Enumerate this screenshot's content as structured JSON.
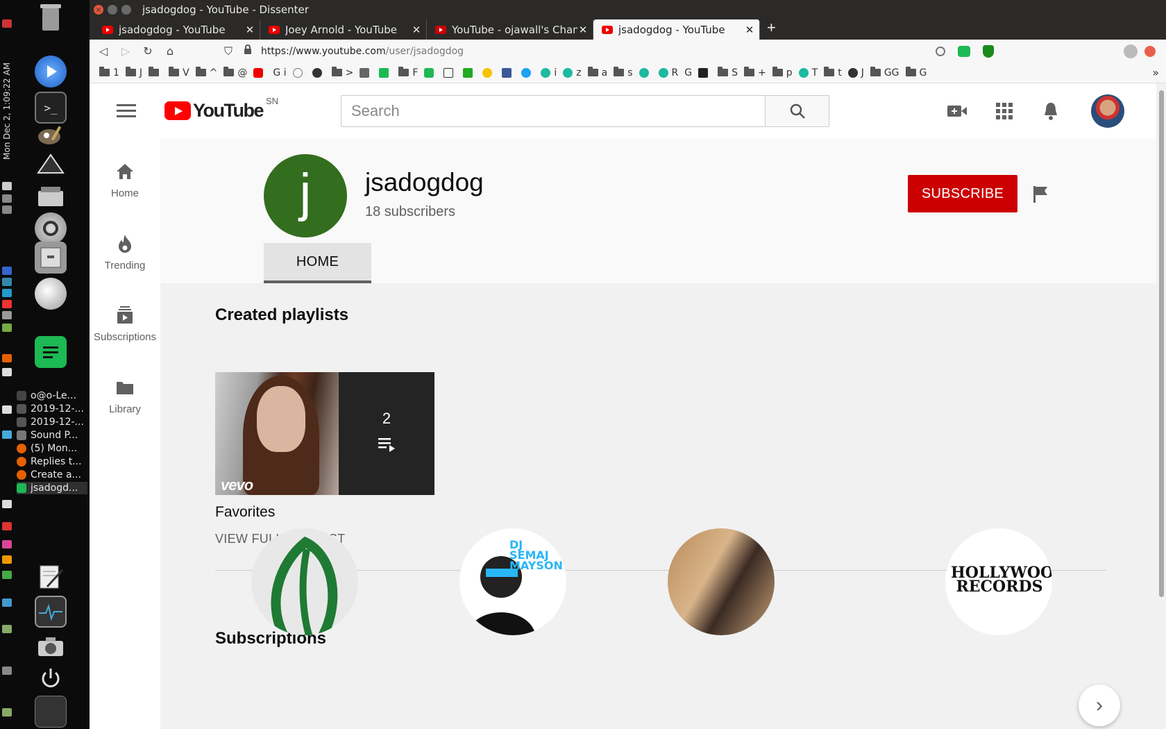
{
  "os": {
    "clock": "Mon Dec 2, 1:09:22 AM",
    "taskbar": [
      {
        "label": "o@o-Le...",
        "color": "#444444"
      },
      {
        "label": "2019-12-...",
        "color": "#555555"
      },
      {
        "label": "2019-12-...",
        "color": "#555555"
      },
      {
        "label": "Sound P...",
        "color": "#777777"
      },
      {
        "label": "(5) Mon...",
        "color": "#e66000"
      },
      {
        "label": "Replies t...",
        "color": "#e66000"
      },
      {
        "label": "Create a...",
        "color": "#e66000"
      },
      {
        "label": "jsadogd...",
        "color": "#1db954"
      }
    ]
  },
  "browser": {
    "window_title": "jsadogdog - YouTube - Dissenter",
    "tabs": [
      {
        "label": "jsadogdog - YouTube",
        "active": false
      },
      {
        "label": "Joey Arnold - YouTube",
        "active": false
      },
      {
        "label": "YouTube - ojawall's Channe",
        "active": false
      },
      {
        "label": "jsadogdog - YouTube",
        "active": true
      }
    ],
    "url_host": "https://www.youtube.com",
    "url_path": "/user/jsadogdog",
    "bookmarks": [
      "1",
      "J",
      "",
      "V",
      "^",
      "@",
      "",
      "G i",
      "",
      "",
      ">",
      "",
      "",
      "F",
      "",
      "",
      "",
      "",
      "",
      "",
      "i",
      "z",
      "a",
      "s",
      "",
      "R",
      "G",
      "",
      "S",
      "+",
      "p",
      "T",
      "t",
      "J",
      "GG",
      "G"
    ],
    "bookmarks_more": "»"
  },
  "youtube": {
    "logo_word": "YouTube",
    "country_code": "SN",
    "search_placeholder": "Search",
    "guide": [
      {
        "label": "Home",
        "icon": "home-icon"
      },
      {
        "label": "Trending",
        "icon": "flame-icon"
      },
      {
        "label": "Subscriptions",
        "icon": "subscriptions-icon"
      },
      {
        "label": "Library",
        "icon": "folder-icon"
      }
    ],
    "channel": {
      "avatar_letter": "j",
      "name": "jsadogdog",
      "subscribers": "18 subscribers",
      "subscribe_label": "SUBSCRIBE",
      "tab_home": "HOME",
      "avatar_color": "#336d1e"
    },
    "sections": {
      "playlists_title": "Created playlists",
      "playlist": {
        "title": "Favorites",
        "video_count": "2",
        "thumb_badge": "vevo",
        "view_full": "VIEW FULL PLAYLIST"
      },
      "subscriptions_title": "Subscriptions",
      "subscriptions": [
        {
          "name": "onion-logo-channel"
        },
        {
          "name": "dj-channel",
          "text": "DJ SEMAJ MAYSON"
        },
        {
          "name": "portrait-channel"
        },
        {
          "name": "hollywood-records-channel",
          "text": "HOLLYWOOD RECORDS"
        }
      ],
      "next_arrow": "›"
    },
    "colors": {
      "brand_red": "#ff0000",
      "subscribe_red": "#cc0000"
    }
  }
}
